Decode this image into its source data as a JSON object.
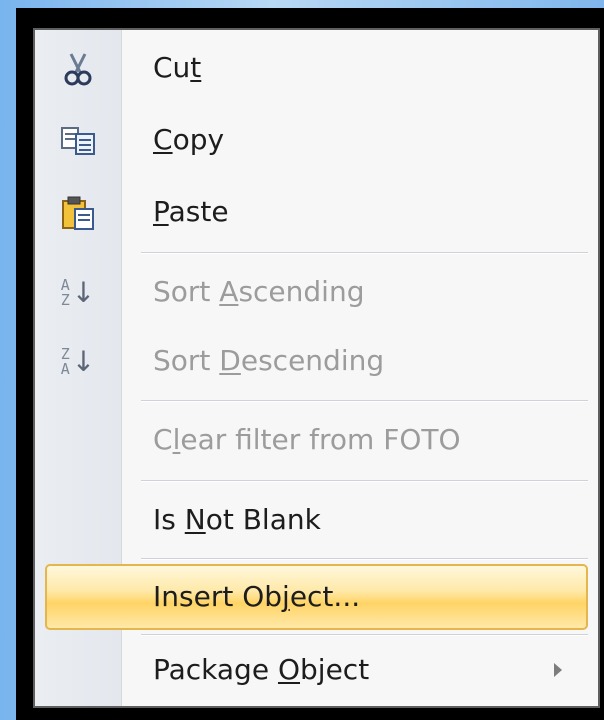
{
  "menu": {
    "items": [
      {
        "label_pre": "Cu",
        "label_ul": "t",
        "label_post": "",
        "icon": "scissors-icon",
        "enabled": true
      },
      {
        "label_pre": "",
        "label_ul": "C",
        "label_post": "opy",
        "icon": "copy-icon",
        "enabled": true
      },
      {
        "label_pre": "",
        "label_ul": "P",
        "label_post": "aste",
        "icon": "paste-icon",
        "enabled": true
      },
      {
        "label_pre": "Sort ",
        "label_ul": "A",
        "label_post": "scending",
        "icon": "sort-ascending-icon",
        "enabled": false
      },
      {
        "label_pre": "Sort ",
        "label_ul": "D",
        "label_post": "escending",
        "icon": "sort-descending-icon",
        "enabled": false
      },
      {
        "label_pre": "C",
        "label_ul": "l",
        "label_post": "ear filter from FOTO",
        "icon": "",
        "enabled": false
      },
      {
        "label_pre": "Is ",
        "label_ul": "N",
        "label_post": "ot Blank",
        "icon": "",
        "enabled": true
      },
      {
        "label_pre": "Insert Ob",
        "label_ul": "j",
        "label_post": "ect...",
        "icon": "",
        "enabled": true,
        "selected": true
      },
      {
        "label_pre": "Package ",
        "label_ul": "O",
        "label_post": "bject",
        "icon": "",
        "enabled": true,
        "has_submenu": true
      }
    ],
    "sort_icons": {
      "ascending_top": "A",
      "ascending_bottom": "Z",
      "descending_top": "Z",
      "descending_bottom": "A",
      "arrow": "↓"
    },
    "colors": {
      "highlight": "#ffd466",
      "highlight_border": "#e5b64d",
      "disabled_text": "#9c9c9c",
      "text": "#1d1d1d"
    }
  }
}
